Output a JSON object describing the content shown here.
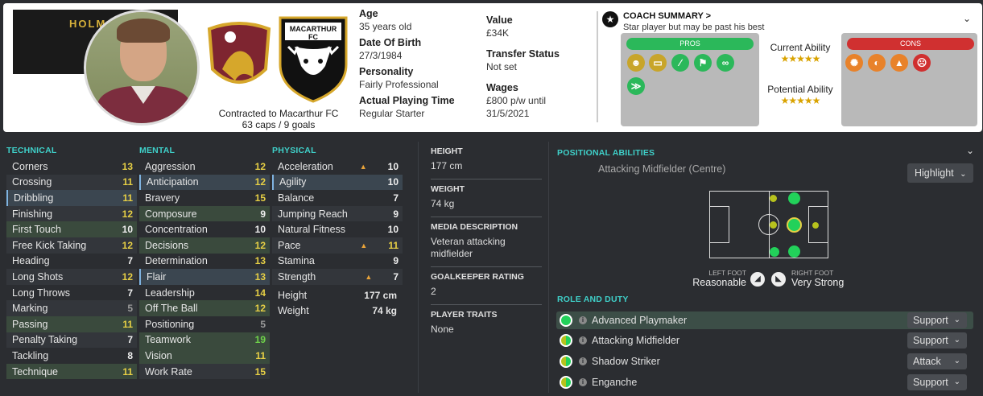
{
  "header": {
    "player_name_banner": "HOLM",
    "contract_line": "Contracted to Macarthur FC",
    "caps_goals": "63 caps / 9 goals",
    "club_crest_text": "MACARTHUR FC",
    "age_label": "Age",
    "age_value": "35 years old",
    "dob_label": "Date Of Birth",
    "dob_value": "27/3/1984",
    "personality_label": "Personality",
    "personality_value": "Fairly Professional",
    "playing_time_label": "Actual Playing Time",
    "playing_time_value": "Regular Starter",
    "value_label": "Value",
    "value_value": "£34K",
    "transfer_label": "Transfer Status",
    "transfer_value": "Not set",
    "wages_label": "Wages",
    "wages_value": "£800 p/w until",
    "wages_until": "31/5/2021"
  },
  "coach": {
    "title": "COACH SUMMARY >",
    "summary": "Star player but may be past his best",
    "pros_label": "PROS",
    "cons_label": "CONS",
    "current_ability_label": "Current Ability",
    "potential_ability_label": "Potential Ability",
    "current_stars": "★★★★★",
    "potential_stars": "★★★★★",
    "current_ability_stars": 5,
    "potential_ability_stars": 5,
    "pros_icons": [
      "brain-icon",
      "field-icon",
      "boot-icon",
      "flag-icon",
      "link-icon",
      "wings-icon"
    ],
    "cons_icons": [
      "fist-icon",
      "shirt-icon",
      "cone-icon",
      "head-icon"
    ]
  },
  "technical": {
    "title": "TECHNICAL",
    "rows": [
      {
        "label": "Corners",
        "value": "13"
      },
      {
        "label": "Crossing",
        "value": "11"
      },
      {
        "label": "Dribbling",
        "value": "11"
      },
      {
        "label": "Finishing",
        "value": "12"
      },
      {
        "label": "First Touch",
        "value": "10"
      },
      {
        "label": "Free Kick Taking",
        "value": "12"
      },
      {
        "label": "Heading",
        "value": "7"
      },
      {
        "label": "Long Shots",
        "value": "12"
      },
      {
        "label": "Long Throws",
        "value": "7"
      },
      {
        "label": "Marking",
        "value": "5"
      },
      {
        "label": "Passing",
        "value": "11"
      },
      {
        "label": "Penalty Taking",
        "value": "7"
      },
      {
        "label": "Tackling",
        "value": "8"
      },
      {
        "label": "Technique",
        "value": "11"
      }
    ]
  },
  "mental": {
    "title": "MENTAL",
    "rows": [
      {
        "label": "Aggression",
        "value": "12"
      },
      {
        "label": "Anticipation",
        "value": "12"
      },
      {
        "label": "Bravery",
        "value": "15"
      },
      {
        "label": "Composure",
        "value": "9"
      },
      {
        "label": "Concentration",
        "value": "10"
      },
      {
        "label": "Decisions",
        "value": "12"
      },
      {
        "label": "Determination",
        "value": "13"
      },
      {
        "label": "Flair",
        "value": "13"
      },
      {
        "label": "Leadership",
        "value": "14"
      },
      {
        "label": "Off The Ball",
        "value": "12"
      },
      {
        "label": "Positioning",
        "value": "5"
      },
      {
        "label": "Teamwork",
        "value": "19"
      },
      {
        "label": "Vision",
        "value": "11"
      },
      {
        "label": "Work Rate",
        "value": "15"
      }
    ]
  },
  "physical": {
    "title": "PHYSICAL",
    "rows": [
      {
        "label": "Acceleration",
        "value": "10"
      },
      {
        "label": "Agility",
        "value": "10"
      },
      {
        "label": "Balance",
        "value": "7"
      },
      {
        "label": "Jumping Reach",
        "value": "9"
      },
      {
        "label": "Natural Fitness",
        "value": "10"
      },
      {
        "label": "Pace",
        "value": "11"
      },
      {
        "label": "Stamina",
        "value": "9"
      },
      {
        "label": "Strength",
        "value": "7"
      }
    ],
    "height_label": "Height",
    "height_value": "177 cm",
    "weight_label": "Weight",
    "weight_value": "74 kg"
  },
  "middle": {
    "height_label": "HEIGHT",
    "height_value": "177 cm",
    "weight_label": "WEIGHT",
    "weight_value": "74 kg",
    "media_label": "MEDIA DESCRIPTION",
    "media_value": "Veteran attacking midfielder",
    "gk_label": "GOALKEEPER RATING",
    "gk_value": "2",
    "traits_label": "PLAYER TRAITS",
    "traits_value": "None"
  },
  "positions": {
    "title": "POSITIONAL ABILITIES",
    "main_position": "Attacking Midfielder (Centre)",
    "highlight_label": "Highlight",
    "left_foot_label": "LEFT FOOT",
    "left_foot_value": "Reasonable",
    "right_foot_label": "RIGHT FOOT",
    "right_foot_value": "Very Strong"
  },
  "roles": {
    "title": "ROLE AND DUTY",
    "items": [
      {
        "name": "Advanced Playmaker",
        "duty": "Support"
      },
      {
        "name": "Attacking Midfielder",
        "duty": "Support"
      },
      {
        "name": "Shadow Striker",
        "duty": "Attack"
      },
      {
        "name": "Enganche",
        "duty": "Support"
      }
    ]
  },
  "colors": {
    "accent": "#3fd0c9",
    "pros": "#2bb85a",
    "cons": "#d03030",
    "star": "#d9a300"
  }
}
